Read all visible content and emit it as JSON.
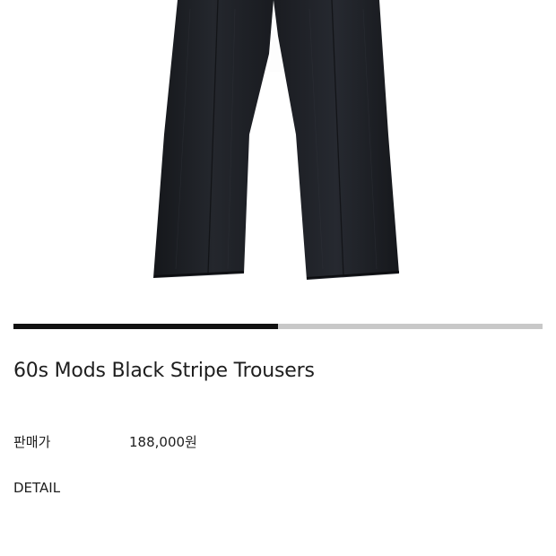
{
  "product": {
    "image_alt": "black wide trousers product photo",
    "gallery_progress": 0.5,
    "title": "60s Mods Black Stripe Trousers",
    "price_label": "판매가",
    "price_value": "188,000원",
    "detail_label": "DETAIL"
  },
  "colors": {
    "garment": "#1d1f24",
    "progress_fill": "#111111",
    "progress_track": "#c8c8c8"
  }
}
